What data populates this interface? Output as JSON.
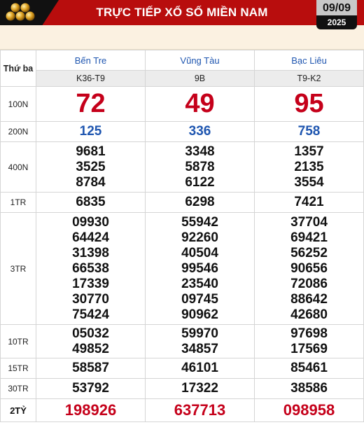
{
  "header": {
    "title": "TRỰC TIẾP XỔ SỐ MIỀN NAM",
    "date_day": "09/09",
    "date_year": "2025"
  },
  "table": {
    "day_label": "Thứ ba",
    "provinces": [
      {
        "name": "Bến Tre",
        "code": "K36-T9"
      },
      {
        "name": "Vũng Tàu",
        "code": "9B"
      },
      {
        "name": "Bạc Liêu",
        "code": "T9-K2"
      }
    ],
    "prizes": [
      {
        "label": "100N",
        "values": [
          [
            "72"
          ],
          [
            "49"
          ],
          [
            "95"
          ]
        ]
      },
      {
        "label": "200N",
        "values": [
          [
            "125"
          ],
          [
            "336"
          ],
          [
            "758"
          ]
        ]
      },
      {
        "label": "400N",
        "values": [
          [
            "9681",
            "3525",
            "8784"
          ],
          [
            "3348",
            "5878",
            "6122"
          ],
          [
            "1357",
            "2135",
            "3554"
          ]
        ]
      },
      {
        "label": "1TR",
        "values": [
          [
            "6835"
          ],
          [
            "6298"
          ],
          [
            "7421"
          ]
        ]
      },
      {
        "label": "3TR",
        "values": [
          [
            "09930",
            "64424",
            "31398",
            "66538",
            "17339",
            "30770",
            "75424"
          ],
          [
            "55942",
            "92260",
            "40504",
            "99546",
            "23540",
            "09745",
            "90962"
          ],
          [
            "37704",
            "69421",
            "56252",
            "90656",
            "72086",
            "88642",
            "42680"
          ]
        ]
      },
      {
        "label": "10TR",
        "values": [
          [
            "05032",
            "49852"
          ],
          [
            "59970",
            "34857"
          ],
          [
            "97698",
            "17569"
          ]
        ]
      },
      {
        "label": "15TR",
        "values": [
          [
            "58587"
          ],
          [
            "46101"
          ],
          [
            "85461"
          ]
        ]
      },
      {
        "label": "30TR",
        "values": [
          [
            "53792"
          ],
          [
            "17322"
          ],
          [
            "38586"
          ]
        ]
      },
      {
        "label": "2TỶ",
        "values": [
          [
            "198926"
          ],
          [
            "637713"
          ],
          [
            "098958"
          ]
        ]
      }
    ]
  },
  "colors": {
    "banner": "#b80d0d",
    "special_prize": "#c5001a",
    "province_name": "#1f56b0"
  },
  "icons": {
    "logo": "gold-balls-logo-icon"
  }
}
